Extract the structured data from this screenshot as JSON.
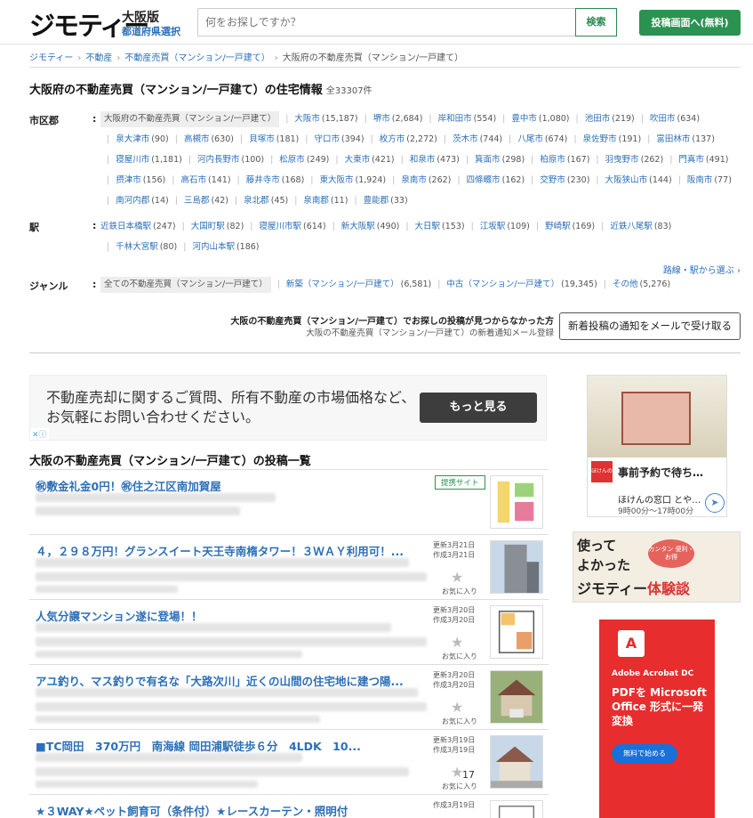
{
  "header": {
    "logo": "ジモティー",
    "prefecture": "大阪版",
    "prefecture_link": "都道府県選択",
    "search_placeholder": "何をお探しですか？",
    "search_button": "検索",
    "post_button": "投稿画面へ(無料)"
  },
  "breadcrumb": [
    "ジモティー",
    "不動産",
    "不動産売買（マンション/一戸建て）",
    "大阪府の不動産売買（マンション/一戸建て）"
  ],
  "page": {
    "title": "大阪府の不動産売買（マンション/一戸建て）の住宅情報",
    "count": "全33307件"
  },
  "filters": {
    "city_label": "市区郡",
    "colon": ":",
    "cities": [
      {
        "name": "大阪府の不動産売買（マンション/一戸建て）",
        "count": "",
        "selected": true
      },
      {
        "name": "大阪市",
        "count": "(15,187)"
      },
      {
        "name": "堺市",
        "count": "(2,684)"
      },
      {
        "name": "岸和田市",
        "count": "(554)"
      },
      {
        "name": "豊中市",
        "count": "(1,080)"
      },
      {
        "name": "池田市",
        "count": "(219)"
      },
      {
        "name": "吹田市",
        "count": "(634)"
      },
      {
        "name": "泉大津市",
        "count": "(90)"
      },
      {
        "name": "高槻市",
        "count": "(630)"
      },
      {
        "name": "貝塚市",
        "count": "(181)"
      },
      {
        "name": "守口市",
        "count": "(394)"
      },
      {
        "name": "枚方市",
        "count": "(2,272)"
      },
      {
        "name": "茨木市",
        "count": "(744)"
      },
      {
        "name": "八尾市",
        "count": "(674)"
      },
      {
        "name": "泉佐野市",
        "count": "(191)"
      },
      {
        "name": "富田林市",
        "count": "(137)"
      },
      {
        "name": "寝屋川市",
        "count": "(1,181)"
      },
      {
        "name": "河内長野市",
        "count": "(100)"
      },
      {
        "name": "松原市",
        "count": "(249)"
      },
      {
        "name": "大東市",
        "count": "(421)"
      },
      {
        "name": "和泉市",
        "count": "(473)"
      },
      {
        "name": "箕面市",
        "count": "(298)"
      },
      {
        "name": "柏原市",
        "count": "(167)"
      },
      {
        "name": "羽曳野市",
        "count": "(262)"
      },
      {
        "name": "門真市",
        "count": "(491)"
      },
      {
        "name": "摂津市",
        "count": "(156)"
      },
      {
        "name": "高石市",
        "count": "(141)"
      },
      {
        "name": "藤井寺市",
        "count": "(168)"
      },
      {
        "name": "東大阪市",
        "count": "(1,924)"
      },
      {
        "name": "泉南市",
        "count": "(262)"
      },
      {
        "name": "四條畷市",
        "count": "(162)"
      },
      {
        "name": "交野市",
        "count": "(230)"
      },
      {
        "name": "大阪狭山市",
        "count": "(144)"
      },
      {
        "name": "阪南市",
        "count": "(77)"
      },
      {
        "name": "南河内郡",
        "count": "(14)"
      },
      {
        "name": "三島郡",
        "count": "(42)"
      },
      {
        "name": "泉北郡",
        "count": "(45)"
      },
      {
        "name": "泉南郡",
        "count": "(11)"
      },
      {
        "name": "豊能郡",
        "count": "(33)"
      }
    ],
    "station_label": "駅",
    "stations": [
      {
        "name": "近鉄日本橋駅",
        "count": "(247)"
      },
      {
        "name": "大国町駅",
        "count": "(82)"
      },
      {
        "name": "寝屋川市駅",
        "count": "(614)"
      },
      {
        "name": "新大阪駅",
        "count": "(490)"
      },
      {
        "name": "大日駅",
        "count": "(153)"
      },
      {
        "name": "江坂駅",
        "count": "(109)"
      },
      {
        "name": "野崎駅",
        "count": "(169)"
      },
      {
        "name": "近鉄八尾駅",
        "count": "(83)"
      },
      {
        "name": "千林大宮駅",
        "count": "(80)"
      },
      {
        "name": "河内山本駅",
        "count": "(186)"
      }
    ],
    "more_link": "路線・駅から選ぶ ›",
    "genre_label": "ジャンル",
    "genres": [
      {
        "name": "全ての不動産売買（マンション/一戸建て）",
        "count": "",
        "selected": true
      },
      {
        "name": "新築（マンション/一戸建て）",
        "count": "(6,581)"
      },
      {
        "name": "中古（マンション/一戸建て）",
        "count": "(19,345)"
      },
      {
        "name": "その他",
        "count": "(5,276)"
      }
    ]
  },
  "notify": {
    "main": "大阪の不動産売買（マンション/一戸建て）でお探しの投稿が見つからなかった方",
    "sub": "大阪の不動産売買（マンション/一戸建て）の新着通知メール登録",
    "button": "新着投稿の通知をメールで受け取る"
  },
  "ad_banner": {
    "text": "不動産売却に関するご質問、所有不動産の市場価格など、お気軽にお問い合わせください。",
    "button": "もっと見る",
    "ad_mark": "✕ⓘ"
  },
  "list": {
    "title": "大阪の不動産売買（マンション/一戸建て）の投稿一覧",
    "items": [
      {
        "title": "㊗敷金礼金0円！㊗住之江区南加賀屋",
        "badge": "提携サイト",
        "updated": "",
        "created": "",
        "fav": "",
        "stars": ""
      },
      {
        "title": "４，２９８万円！グランスイート天王寺南楕タワー！３ＷＡＹ利用可！...",
        "updated": "更新3月21日",
        "created": "作成3月21日",
        "fav": "お気に入り",
        "stars": ""
      },
      {
        "title": "人気分譲マンション遂に登場！！",
        "updated": "更新3月20日",
        "created": "作成3月20日",
        "fav": "お気に入り",
        "stars": ""
      },
      {
        "title": "アユ釣り、マス釣りで有名な「大路次川」近くの山間の住宅地に建つ陽...",
        "updated": "更新3月20日",
        "created": "作成3月20日",
        "fav": "お気に入り",
        "stars": ""
      },
      {
        "title": "■TC岡田　370万円　南海線 岡田浦駅徒歩６分　4LDK　10...",
        "updated": "更新3月19日",
        "created": "作成3月19日",
        "fav": "お気に入り",
        "stars": "17"
      },
      {
        "title": "★３WAY★ペット飼育可（条件付）★レースカーテン・照明付",
        "updated": "作成3月19日",
        "created": "",
        "fav": "",
        "stars": ""
      }
    ]
  },
  "side_ads": {
    "ad1_title": "事前予約で待ち…",
    "ad1_sub1": "ほけんの窓口 とや…",
    "ad1_sub2": "9時00分〜17時00分",
    "ad1_logo": "ほけんの窓口",
    "ad2_line1": "使って",
    "ad2_line2": "よかった",
    "ad2_brand": "ジモティー",
    "ad2_brand_red": "体験談",
    "ad2_bubble": "カンタン 便利・お得",
    "ad3_brand": "Adobe Acrobat DC",
    "ad3_text": "PDFを Microsoft Office 形式に一発変換",
    "ad3_button": "無料で始める"
  }
}
